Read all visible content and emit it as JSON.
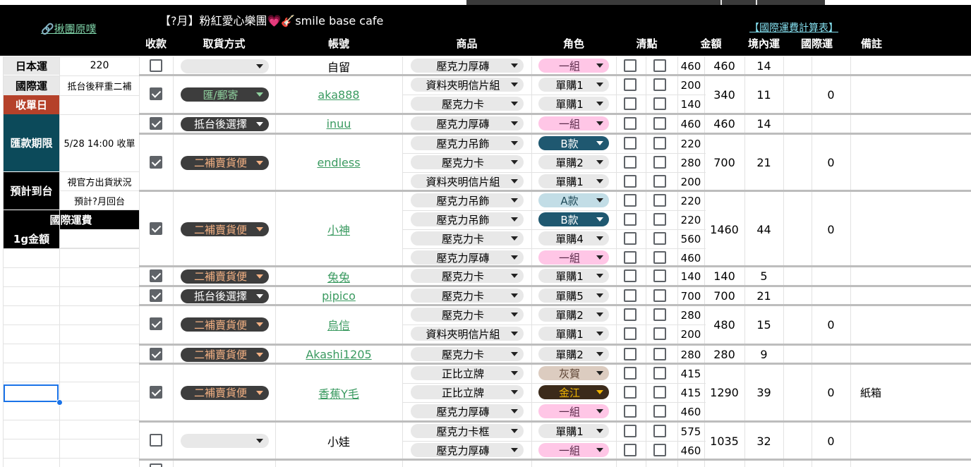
{
  "app": {
    "title": "【?月】粉紅愛心樂團💗🎸smile base cafe",
    "left_link": "🔗揪團原噗",
    "right_link": "【國際運費計算表】"
  },
  "headers": [
    "收款",
    "取貨方式",
    "帳號",
    "商品",
    "角色",
    "清點",
    "金額",
    "境內運",
    "國際運",
    "備註"
  ],
  "left_panel": [
    {
      "label": "日本運",
      "value": "220"
    },
    {
      "label": "國際運",
      "value": "抵台後秤重二補"
    },
    {
      "label": "收單日",
      "value": ""
    },
    {
      "label": "匯款期限",
      "value": "5/28 14:00 收單"
    },
    {
      "label": "預計到台",
      "value": "視官方出貨狀況"
    },
    {
      "label": "",
      "value": "預計?月回台"
    },
    {
      "label": "國際運費",
      "value": ""
    },
    {
      "label": "1g金額",
      "value": ""
    }
  ],
  "colors": {
    "header_bg": "#000000",
    "label_red": "#b5412a",
    "label_teal": "#0c4a5a",
    "chip_dark": "#3d3d3d",
    "chip_dark_orange": "#f4b183",
    "chip_dark_green": "#8fd19e",
    "chip_pink": "#ffc6e6",
    "chip_navy": "#1f5870",
    "chip_lightblue": "#c2dde6",
    "chip_tan": "#dcccc0",
    "chip_brown": "#3b2a1a",
    "chip_gold": "#f0b400",
    "chip_gray": "#e8e8e8",
    "link_green": "#3a9a60"
  },
  "orders": [
    {
      "paid": false,
      "pickup": "",
      "account": "自留",
      "link": false,
      "total": "460",
      "domestic": "14",
      "intl": "",
      "items": [
        {
          "product": "壓克力厚磚",
          "role": "一組",
          "role_style": "pink",
          "price": "460"
        }
      ]
    },
    {
      "paid": true,
      "pickup": "匯/郵寄",
      "pickup_style": "dark-green",
      "account": "aka888",
      "link": true,
      "total": "340",
      "domestic": "11",
      "intl": "0",
      "items": [
        {
          "product": "資料夾明信片組",
          "role": "單購1",
          "role_style": "gray",
          "price": "200"
        },
        {
          "product": "壓克力卡",
          "role": "單購1",
          "role_style": "gray",
          "price": "140"
        }
      ]
    },
    {
      "paid": true,
      "pickup": "抵台後選擇",
      "pickup_style": "dark-white",
      "account": "inuu",
      "link": true,
      "total": "460",
      "domestic": "14",
      "intl": "",
      "items": [
        {
          "product": "壓克力厚磚",
          "role": "一組",
          "role_style": "pink",
          "price": "460"
        }
      ]
    },
    {
      "paid": true,
      "pickup": "二補賣貨便",
      "pickup_style": "dark-orange",
      "account": "endless",
      "link": true,
      "total": "700",
      "domestic": "21",
      "intl": "0",
      "items": [
        {
          "product": "壓克力吊飾",
          "role": "B款",
          "role_style": "navy",
          "price": "220"
        },
        {
          "product": "壓克力卡",
          "role": "單購2",
          "role_style": "gray",
          "price": "280"
        },
        {
          "product": "資料夾明信片組",
          "role": "單購1",
          "role_style": "gray",
          "price": "200"
        }
      ]
    },
    {
      "paid": true,
      "pickup": "二補賣貨便",
      "pickup_style": "dark-orange",
      "account": "小神",
      "link": true,
      "total": "1460",
      "domestic": "44",
      "intl": "0",
      "items": [
        {
          "product": "壓克力吊飾",
          "role": "A款",
          "role_style": "lightblue",
          "price": "220"
        },
        {
          "product": "壓克力吊飾",
          "role": "B款",
          "role_style": "navy",
          "price": "220"
        },
        {
          "product": "壓克力卡",
          "role": "單購4",
          "role_style": "gray",
          "price": "560"
        },
        {
          "product": "壓克力厚磚",
          "role": "一組",
          "role_style": "pink",
          "price": "460"
        }
      ]
    },
    {
      "paid": true,
      "pickup": "二補賣貨便",
      "pickup_style": "dark-orange",
      "account": "兔兔",
      "link": true,
      "total": "140",
      "domestic": "5",
      "intl": "",
      "items": [
        {
          "product": "壓克力卡",
          "role": "單購1",
          "role_style": "gray",
          "price": "140"
        }
      ]
    },
    {
      "paid": true,
      "pickup": "抵台後選擇",
      "pickup_style": "dark-white",
      "account": "pipico",
      "link": true,
      "total": "700",
      "domestic": "21",
      "intl": "",
      "items": [
        {
          "product": "壓克力卡",
          "role": "單購5",
          "role_style": "gray",
          "price": "700"
        }
      ]
    },
    {
      "paid": true,
      "pickup": "二補賣貨便",
      "pickup_style": "dark-orange",
      "account": "烏信",
      "link": true,
      "total": "480",
      "domestic": "15",
      "intl": "0",
      "items": [
        {
          "product": "壓克力卡",
          "role": "單購2",
          "role_style": "gray",
          "price": "280"
        },
        {
          "product": "資料夾明信片組",
          "role": "單購1",
          "role_style": "gray",
          "price": "200"
        }
      ]
    },
    {
      "paid": true,
      "pickup": "二補賣貨便",
      "pickup_style": "dark-orange",
      "account": "Akashi1205",
      "link": true,
      "total": "280",
      "domestic": "9",
      "intl": "",
      "items": [
        {
          "product": "壓克力卡",
          "role": "單購2",
          "role_style": "gray",
          "price": "280"
        }
      ]
    },
    {
      "paid": true,
      "pickup": "二補賣貨便",
      "pickup_style": "dark-orange",
      "account": "香蕉Y毛",
      "link": true,
      "total": "1290",
      "domestic": "39",
      "intl": "0",
      "note": "紙箱",
      "items": [
        {
          "product": "正比立牌",
          "role": "灰賀",
          "role_style": "tan",
          "price": "415"
        },
        {
          "product": "正比立牌",
          "role": "金江",
          "role_style": "brown",
          "price": "415"
        },
        {
          "product": "壓克力厚磚",
          "role": "一組",
          "role_style": "pink",
          "price": "460"
        }
      ]
    },
    {
      "paid": false,
      "pickup": "",
      "account": "小娃",
      "link": false,
      "total": "1035",
      "domestic": "32",
      "intl": "0",
      "items": [
        {
          "product": "壓克力卡框",
          "role": "單購1",
          "role_style": "gray",
          "price": "575"
        },
        {
          "product": "壓克力厚磚",
          "role": "一組",
          "role_style": "pink",
          "price": "460"
        }
      ]
    }
  ]
}
